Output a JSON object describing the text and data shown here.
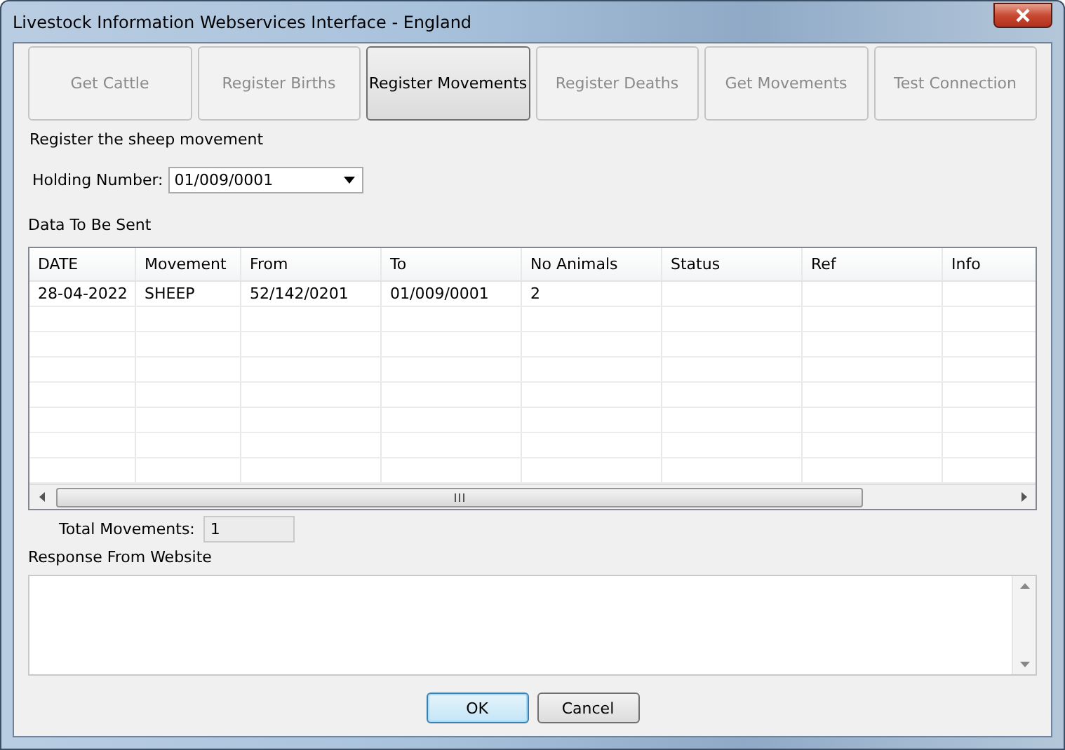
{
  "window": {
    "title": "Livestock Information Webservices Interface - England"
  },
  "tabs": [
    {
      "label": "Get Cattle",
      "selected": false
    },
    {
      "label": "Register Births",
      "selected": false
    },
    {
      "label": "Register Movements",
      "selected": true
    },
    {
      "label": "Register Deaths",
      "selected": false
    },
    {
      "label": "Get Movements",
      "selected": false
    },
    {
      "label": "Test Connection",
      "selected": false
    }
  ],
  "heading": "Register the sheep movement",
  "holding": {
    "label": "Holding Number:",
    "value": "01/009/0001"
  },
  "data_label": "Data To Be Sent",
  "table": {
    "columns": [
      "DATE",
      "Movement",
      "From",
      "To",
      "No Animals",
      "Status",
      "Ref",
      "Info"
    ],
    "rows": [
      [
        "28-04-2022",
        "SHEEP",
        "52/142/0201",
        "01/009/0001",
        "2"
      ]
    ]
  },
  "total": {
    "label": "Total Movements:",
    "value": "1"
  },
  "response_label": "Response From Website",
  "buttons": [
    {
      "label": "OK",
      "default": true
    },
    {
      "label": "Cancel",
      "default": false
    }
  ]
}
